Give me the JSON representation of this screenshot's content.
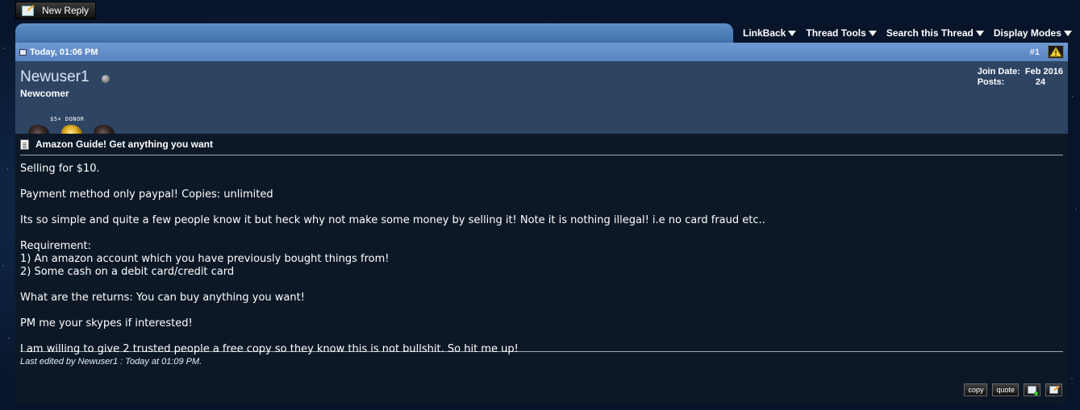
{
  "toolbar": {
    "new_reply": "New Reply",
    "linkback": "LinkBack",
    "thread_tools": "Thread Tools",
    "search_thread": "Search this Thread",
    "display_modes": "Display Modes"
  },
  "post": {
    "date": "Today, 01:06 PM",
    "number": "#1",
    "username": "Newuser1",
    "usertitle": "Newcomer",
    "donor_label": "$5+ DONOR",
    "join_date_label": "Join Date:",
    "join_date_value": "Feb 2016",
    "posts_label": "Posts:",
    "posts_value": "24",
    "title": "Amazon Guide! Get anything you want",
    "message": [
      "Selling for $10.",
      "Payment method only paypal! Copies: unlimited",
      "Its so simple and quite a few people know it but heck why not make some money by selling it! Note it is nothing illegal! i.e no card fraud etc..",
      "Requirement:",
      "1) An amazon account which you have previously bought things from!",
      "2) Some cash on a debit card/credit card",
      "What are the returns: You can buy anything you want!",
      "PM me your skypes if interested!",
      "I am willing to give 2 trusted people a free copy so they know this is not bullshit. So hit me up!"
    ],
    "edited_note": "Last edited by Newuser1 : Today at 01:09 PM.",
    "copy_label": "copy",
    "quote_label": "quote"
  },
  "colors": {
    "header_blue": "#5f8fc8",
    "post_panel": "#2d4463",
    "post_body": "#0d1827"
  }
}
